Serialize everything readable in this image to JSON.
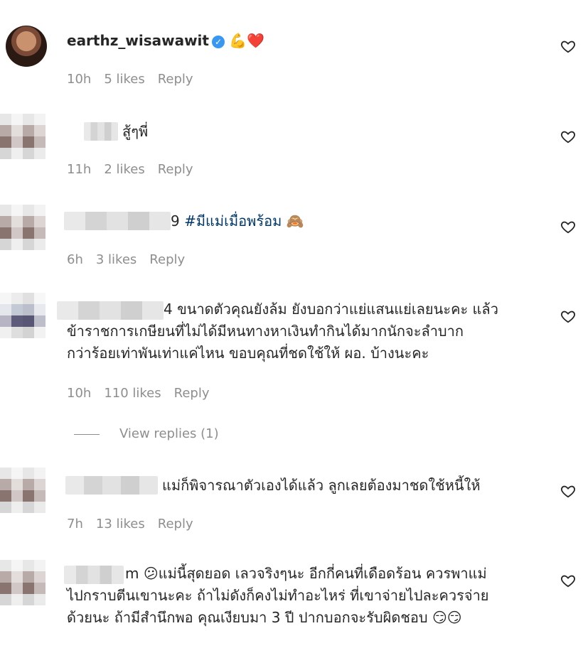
{
  "comments": [
    {
      "username": "earthz_wisawawit",
      "text": "💪❤️",
      "time": "10h",
      "likes": "5 likes",
      "reply": "Reply"
    },
    {
      "text_visible": "สู้ๆพี่",
      "time": "11h",
      "likes": "2 likes",
      "reply": "Reply"
    },
    {
      "handle_tail": "9",
      "hashtag": "#มีแม่เมื่อพร้อม",
      "emoji": "🙈",
      "time": "6h",
      "likes": "3 likes",
      "reply": "Reply"
    },
    {
      "handle_tail": "4",
      "line1": "ขนาดตัวคุณยังล้ม ยังบอกว่าแย่แสนแย่เลยนะคะ แล้ว",
      "line2": "ข้าราชการเกษียนที่ไม่ได้มีหนทางหาเงินทำกินได้มากนักจะลำบาก",
      "line3": "กว่าร้อยเท่าพันเท่าแค่ไหน ขอบคุณที่ชดใช้ให้ ผอ. บ้างนะคะ",
      "time": "10h",
      "likes": "110 likes",
      "reply": "Reply",
      "view_replies": "View replies (1)"
    },
    {
      "text_visible": "แม่ก็พิจารณาตัวเองได้แล้ว ลูกเลยต้องมาชดใช้หนี้ให้",
      "time": "7h",
      "likes": "13 likes",
      "reply": "Reply"
    },
    {
      "handle_tail": "m",
      "line1": "😕แม่นี้สุดยอด เลวจริงๆนะ อีกกี่คนที่เดือดร้อน ควรพาแม่",
      "line2": "ไปกราบตีนเขานะคะ ถ้าไม่ดังก็คงไม่ทำอะไหร่ ที่เขาจ่ายไปละควรจ่าย",
      "line3": "ด้วยนะ ถ้ามีสำนึกพอ คุณเงียบมา 3 ปี ปากบอกจะรับผิดชอบ 😏😏"
    }
  ],
  "icons": {
    "heart": "heart-outline-icon",
    "verified": "verified-badge-icon"
  },
  "colors": {
    "meta": "#8e8e8e",
    "hashtag": "#00376b",
    "verified": "#3897f0"
  }
}
